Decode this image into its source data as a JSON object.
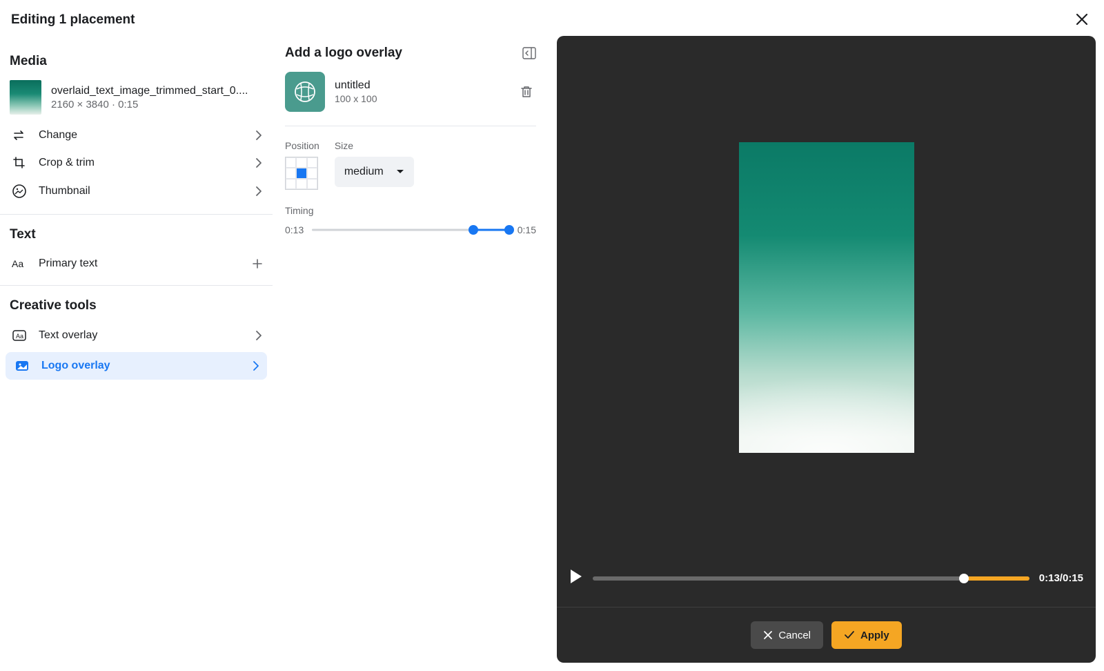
{
  "header": {
    "title": "Editing 1 placement"
  },
  "sidebar": {
    "media_title": "Media",
    "media_name": "overlaid_text_image_trimmed_start_0....",
    "media_meta": "2160 × 3840 · 0:15",
    "change": "Change",
    "crop": "Crop & trim",
    "thumbnail": "Thumbnail",
    "text_title": "Text",
    "primary_text": "Primary text",
    "tools_title": "Creative tools",
    "text_overlay": "Text overlay",
    "logo_overlay": "Logo overlay"
  },
  "overlay": {
    "title": "Add a logo overlay",
    "logo_name": "untitled",
    "logo_dims": "100 x 100",
    "position_label": "Position",
    "size_label": "Size",
    "size_value": "medium",
    "timing_label": "Timing",
    "timing_start": "0:13",
    "timing_end": "0:15"
  },
  "player": {
    "time": "0:13/0:15"
  },
  "actions": {
    "cancel": "Cancel",
    "apply": "Apply"
  }
}
